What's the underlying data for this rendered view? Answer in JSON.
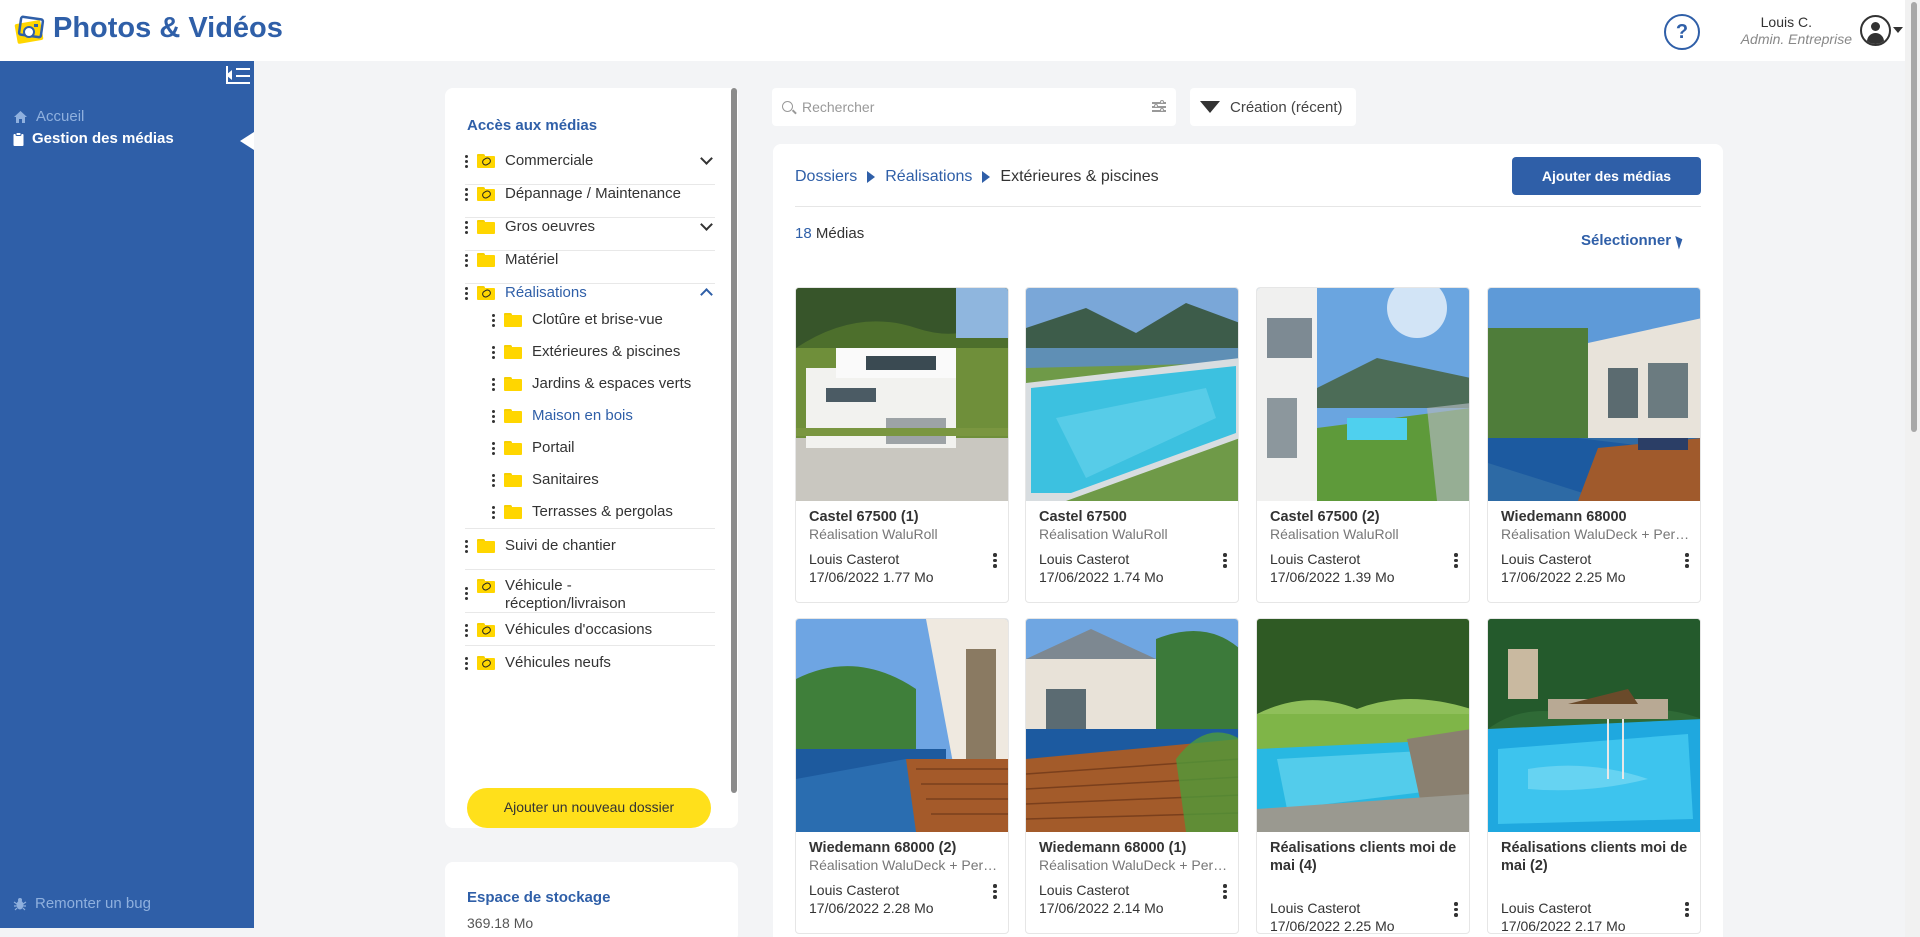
{
  "header": {
    "app_title": "Photos & Vidéos",
    "help_label": "?",
    "user_name": "Louis C.",
    "user_role": "Admin. Entreprise"
  },
  "sidebar": {
    "items": [
      {
        "label": "Accueil",
        "icon": "home-icon",
        "active": false
      },
      {
        "label": "Gestion des médias",
        "icon": "clipboard-icon",
        "active": true
      }
    ],
    "bug_label": "Remonter un bug"
  },
  "folders": {
    "title": "Accès aux médias",
    "items": [
      {
        "label": "Commerciale",
        "icon": "shared-folder-icon",
        "chevron": "down"
      },
      {
        "label": "Dépannage / Maintenance",
        "icon": "shared-folder-icon"
      },
      {
        "label": "Gros oeuvres",
        "icon": "folder-icon",
        "chevron": "down"
      },
      {
        "label": "Matériel",
        "icon": "folder-icon"
      },
      {
        "label": "Réalisations",
        "icon": "shared-folder-icon",
        "chevron": "up",
        "expanded": true,
        "children": [
          {
            "label": "Clotûre et brise-vue"
          },
          {
            "label": "Extérieures & piscines"
          },
          {
            "label": "Jardins & espaces verts"
          },
          {
            "label": "Maison en bois",
            "highlight": true
          },
          {
            "label": "Portail"
          },
          {
            "label": "Sanitaires"
          },
          {
            "label": "Terrasses & pergolas"
          }
        ]
      },
      {
        "label": "Suivi de chantier",
        "icon": "folder-icon"
      },
      {
        "label": "Véhicule - réception/livraison",
        "icon": "shared-folder-icon"
      },
      {
        "label": "Véhicules d'occasions",
        "icon": "shared-folder-icon"
      },
      {
        "label": "Véhicules neufs",
        "icon": "shared-folder-icon"
      }
    ],
    "add_button": "Ajouter un nouveau dossier"
  },
  "storage": {
    "title": "Espace de stockage",
    "value": "369.18 Mo"
  },
  "search": {
    "placeholder": "Rechercher",
    "value": ""
  },
  "sort": {
    "label": "Création (récent)"
  },
  "breadcrumb": [
    "Dossiers",
    "Réalisations",
    "Extérieures & piscines"
  ],
  "add_media_button": "Ajouter des médias",
  "media_count": {
    "number": "18",
    "label": "Médias"
  },
  "select_label": "Sélectionner",
  "media": [
    {
      "title": "Castel 67500 (1)",
      "subtitle": "Réalisation WaluRoll",
      "author": "Louis Casterot",
      "meta": "17/06/2022 1.77 Mo",
      "scene": "house"
    },
    {
      "title": "Castel 67500",
      "subtitle": "Réalisation WaluRoll",
      "author": "Louis Casterot",
      "meta": "17/06/2022 1.74 Mo",
      "scene": "infinity-pool"
    },
    {
      "title": "Castel 67500 (2)",
      "subtitle": "Réalisation WaluRoll",
      "author": "Louis Casterot",
      "meta": "17/06/2022 1.39 Mo",
      "scene": "terrace-pool"
    },
    {
      "title": "Wiedemann 68000",
      "subtitle": "Réalisation WaluDeck + Pergola",
      "author": "Louis Casterot",
      "meta": "17/06/2022 2.25 Mo",
      "scene": "villa-pool"
    },
    {
      "title": "Wiedemann 68000 (2)",
      "subtitle": "Réalisation WaluDeck + Pergola",
      "author": "Louis Casterot",
      "meta": "17/06/2022 2.28 Mo",
      "scene": "deck-pool"
    },
    {
      "title": "Wiedemann 68000 (1)",
      "subtitle": "Réalisation WaluDeck + Pergola",
      "author": "Louis Casterot",
      "meta": "17/06/2022 2.14 Mo",
      "scene": "deck-pool-2"
    },
    {
      "title": "Réalisations clients moi de mai (4)",
      "subtitle": "",
      "author": "Louis Casterot",
      "meta": "17/06/2022 2.25 Mo",
      "scene": "garden-pool"
    },
    {
      "title": "Réalisations clients moi de mai (2)",
      "subtitle": "",
      "author": "Louis Casterot",
      "meta": "17/06/2022 2.17 Mo",
      "scene": "resort-pool"
    }
  ],
  "colors": {
    "brand_blue": "#2f5fa8",
    "accent_yellow": "#ffe01b",
    "folder_yellow": "#ffd600"
  }
}
